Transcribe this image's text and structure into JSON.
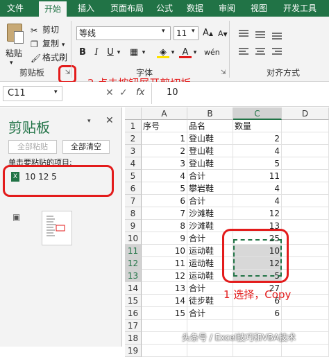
{
  "tabs": [
    "文件",
    "开始",
    "插入",
    "页面布局",
    "公式",
    "数据",
    "审阅",
    "视图",
    "开发工具"
  ],
  "clipboard_group": {
    "paste_label": "粘贴",
    "cut_label": "剪切",
    "copy_label": "复制",
    "format_painter_label": "格式刷",
    "group_label": "剪贴板"
  },
  "font_group": {
    "font_name": "等线",
    "font_size": "11",
    "bold": "B",
    "italic": "I",
    "underline": "U",
    "grow": "A",
    "shrink": "A",
    "group_label": "字体"
  },
  "alignment_group": {
    "group_label": "对齐方式"
  },
  "formula_bar": {
    "name_box": "C11",
    "cancel_symbol": "✕",
    "enter_symbol": "✓",
    "fx": "fx",
    "value": "10"
  },
  "clipboard_pane": {
    "title": "剪贴板",
    "paste_all_label": "全部粘贴",
    "clear_all_label": "全部清空",
    "instruction": "单击要粘贴的项目:",
    "items": [
      {
        "text": "10 12 5"
      }
    ]
  },
  "sheet": {
    "columns": [
      "A",
      "B",
      "C",
      "D"
    ],
    "rows": [
      {
        "n": "1",
        "a": "序号",
        "b": "品名",
        "c": "数量"
      },
      {
        "n": "2",
        "a": "1",
        "b": "登山鞋",
        "c": "2"
      },
      {
        "n": "3",
        "a": "2",
        "b": "登山鞋",
        "c": "4"
      },
      {
        "n": "4",
        "a": "3",
        "b": "登山鞋",
        "c": "5"
      },
      {
        "n": "5",
        "a": "4",
        "b": "合计",
        "c": "11"
      },
      {
        "n": "6",
        "a": "5",
        "b": "攀岩鞋",
        "c": "4"
      },
      {
        "n": "7",
        "a": "6",
        "b": "合计",
        "c": "4"
      },
      {
        "n": "8",
        "a": "7",
        "b": "沙滩鞋",
        "c": "12"
      },
      {
        "n": "9",
        "a": "8",
        "b": "沙滩鞋",
        "c": "13"
      },
      {
        "n": "10",
        "a": "9",
        "b": "合计",
        "c": "25"
      },
      {
        "n": "11",
        "a": "10",
        "b": "运动鞋",
        "c": "10"
      },
      {
        "n": "12",
        "a": "11",
        "b": "运动鞋",
        "c": "12"
      },
      {
        "n": "13",
        "a": "12",
        "b": "运动鞋",
        "c": "5"
      },
      {
        "n": "14",
        "a": "13",
        "b": "合计",
        "c": "27"
      },
      {
        "n": "15",
        "a": "14",
        "b": "徒步鞋",
        "c": "6"
      },
      {
        "n": "16",
        "a": "15",
        "b": "合计",
        "c": "6"
      },
      {
        "n": "17",
        "a": "",
        "b": "",
        "c": ""
      },
      {
        "n": "18",
        "a": "",
        "b": "",
        "c": ""
      },
      {
        "n": "19",
        "a": "",
        "b": "",
        "c": ""
      }
    ]
  },
  "annotations": {
    "step2": "2 点击按钮展开剪切板",
    "step1": "1 选择，Copy"
  },
  "watermark": "头条号 / Excel技巧和VBA技术"
}
